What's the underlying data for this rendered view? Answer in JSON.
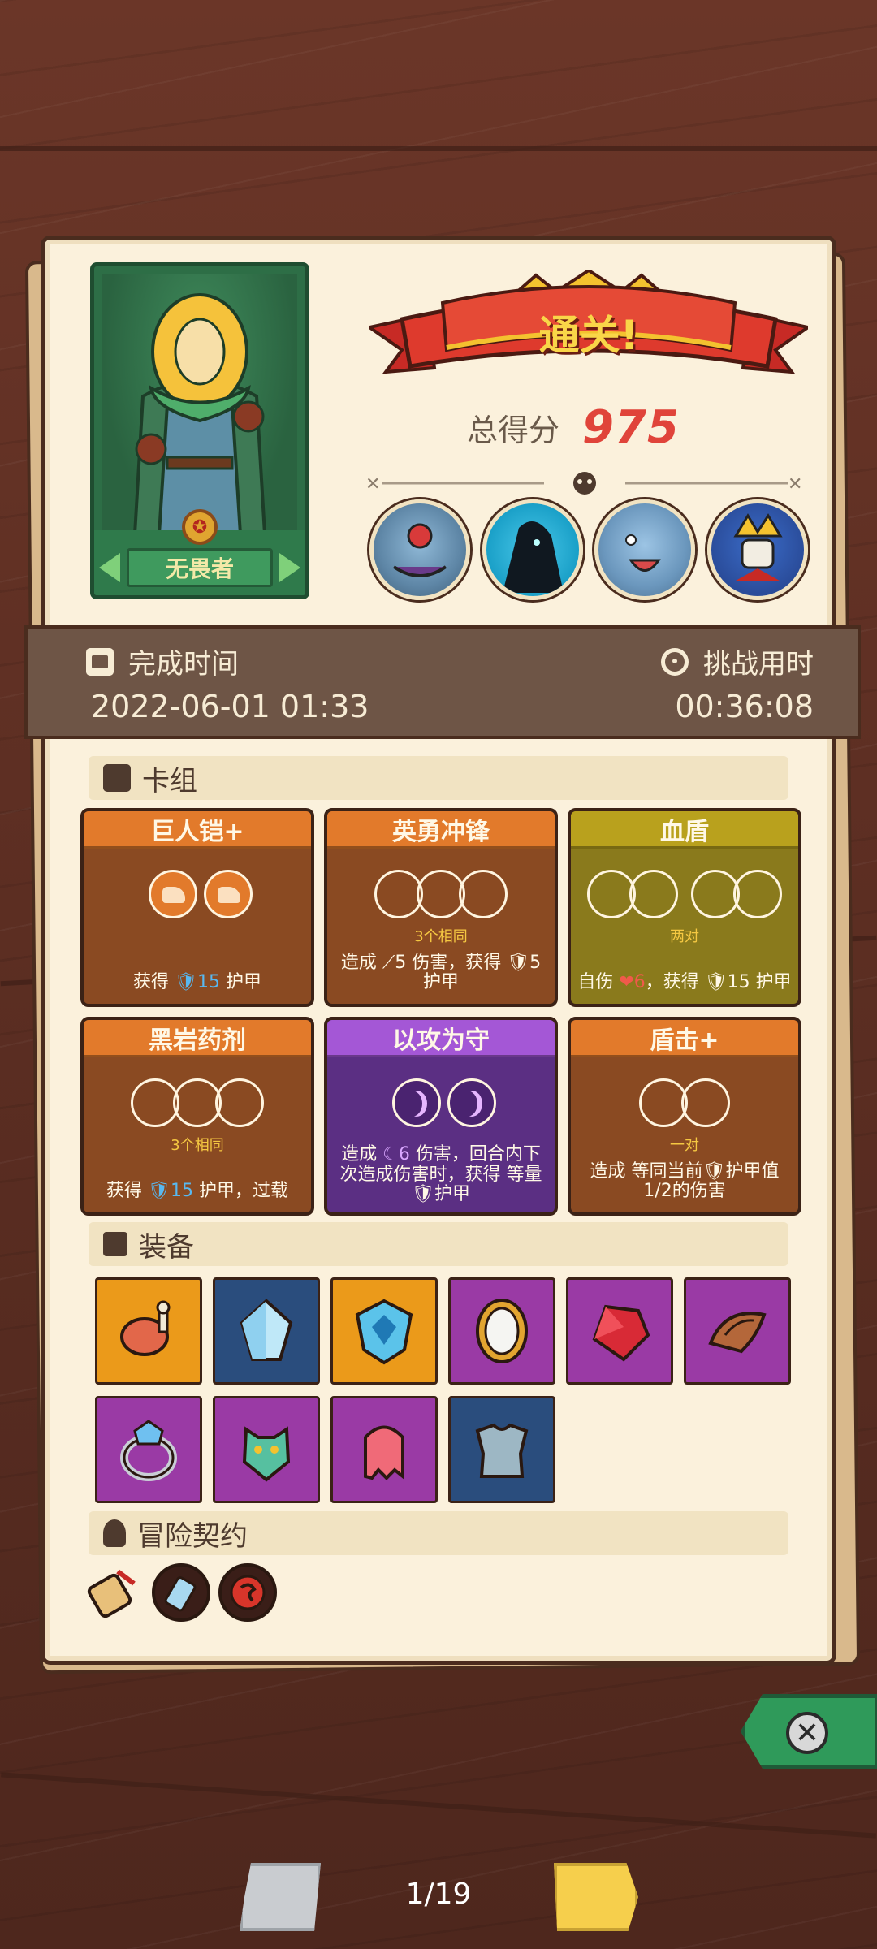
{
  "hero": {
    "name": "无畏者"
  },
  "result": {
    "banner": "通关!",
    "score_label": "总得分",
    "score_value": "975"
  },
  "bosses": [
    "boss-1",
    "boss-2",
    "boss-3",
    "boss-4"
  ],
  "time": {
    "completion_label": "完成时间",
    "completion_value": "2022-06-01 01:33",
    "challenge_label": "挑战用时",
    "challenge_value": "00:36:08"
  },
  "sections": {
    "deck": "卡组",
    "equipment": "装备",
    "contracts": "冒险契约"
  },
  "cards": [
    {
      "title": "巨人铠+",
      "color": "orange",
      "sub": "",
      "desc_pre": "获得 ",
      "desc_num": "🛡15",
      "desc_post": " 护甲"
    },
    {
      "title": "英勇冲锋",
      "color": "orange",
      "sub": "3个相同",
      "desc_pre": "造成 ",
      "desc_num": "⟋5",
      "desc_post": " 伤害，获得 🛡5 护甲"
    },
    {
      "title": "血盾",
      "color": "olive",
      "sub": "两对",
      "desc_pre": "自伤 ",
      "desc_num": "❤6",
      "desc_post": "，获得 🛡15 护甲"
    },
    {
      "title": "黑岩药剂",
      "color": "orange",
      "sub": "3个相同",
      "desc_pre": "获得 ",
      "desc_num": "🛡15",
      "desc_post": " 护甲，过载"
    },
    {
      "title": "以攻为守",
      "color": "purple",
      "sub": "",
      "desc_pre": "造成 ",
      "desc_num": "☾6",
      "desc_post": " 伤害，回合内下次造成伤害时，获得 等量🛡护甲"
    },
    {
      "title": "盾击+",
      "color": "orange",
      "sub": "一对",
      "desc_pre": "造成 ",
      "desc_num": "",
      "desc_post": "等同当前🛡护甲值1/2的伤害"
    }
  ],
  "equipment": [
    {
      "name": "meat-icon",
      "color": "#eb9a1a"
    },
    {
      "name": "crystal-icon",
      "color": "#2a4d7d"
    },
    {
      "name": "shield-gem-icon",
      "color": "#eb9a1a"
    },
    {
      "name": "mirror-icon",
      "color": "#9a3aa5"
    },
    {
      "name": "ruby-icon",
      "color": "#9a3aa5"
    },
    {
      "name": "pauldron-icon",
      "color": "#9a3aa5"
    },
    {
      "name": "ring-icon",
      "color": "#9a3aa5"
    },
    {
      "name": "demon-mask-icon",
      "color": "#9a3aa5"
    },
    {
      "name": "slime-icon",
      "color": "#9a3aa5"
    },
    {
      "name": "armor-icon",
      "color": "#2a4d7d"
    }
  ],
  "contracts": [
    "scroll-icon",
    "bottle-contract-icon",
    "red-seal-icon"
  ],
  "pager": {
    "indicator": "1/19"
  }
}
